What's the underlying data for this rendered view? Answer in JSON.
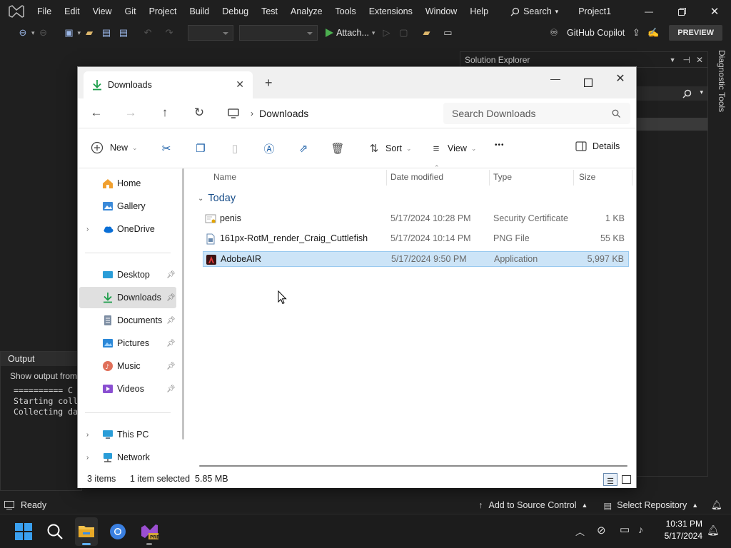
{
  "vs": {
    "menu": [
      "File",
      "Edit",
      "View",
      "Git",
      "Project",
      "Build",
      "Debug",
      "Test",
      "Analyze",
      "Tools",
      "Extensions",
      "Window",
      "Help"
    ],
    "search_label": "Search",
    "project_title": "Project1",
    "toolbar": {
      "attach_label": "Attach...",
      "copilot_label": "GitHub Copilot",
      "preview_label": "PREVIEW"
    },
    "solution_explorer_title": "Solution Explorer",
    "diagnostic_tools_title": "Diagnostic Tools",
    "output": {
      "title": "Output",
      "show_output_from": "Show output from",
      "lines": "========== C\nStarting coll\nCollecting da"
    },
    "status": {
      "ready": "Ready",
      "add_to_source_control": "Add to Source Control",
      "select_repository": "Select Repository"
    }
  },
  "explorer": {
    "tab_title": "Downloads",
    "address": "Downloads",
    "search_placeholder": "Search Downloads",
    "commands": {
      "new": "New",
      "sort": "Sort",
      "view": "View",
      "more": "•••",
      "details": "Details"
    },
    "sidebar": {
      "home": "Home",
      "gallery": "Gallery",
      "onedrive": "OneDrive",
      "desktop": "Desktop",
      "downloads": "Downloads",
      "documents": "Documents",
      "pictures": "Pictures",
      "music": "Music",
      "videos": "Videos",
      "this_pc": "This PC",
      "network": "Network"
    },
    "columns": {
      "name": "Name",
      "date_modified": "Date modified",
      "type": "Type",
      "size": "Size"
    },
    "group_label": "Today",
    "files": [
      {
        "name": "penis",
        "date": "5/17/2024 10:28 PM",
        "type": "Security Certificate",
        "size": "1 KB"
      },
      {
        "name": "161px-RotM_render_Craig_Cuttlefish",
        "date": "5/17/2024 10:14 PM",
        "type": "PNG File",
        "size": "55 KB"
      },
      {
        "name": "AdobeAIR",
        "date": "5/17/2024 9:50 PM",
        "type": "Application",
        "size": "5,997 KB"
      }
    ],
    "status": {
      "items": "3 items",
      "selected": "1 item selected  5.85 MB"
    }
  },
  "taskbar": {
    "time": "10:31 PM",
    "date": "5/17/2024"
  },
  "colors": {
    "vs_bg": "#1f1f1f",
    "selection": "#cce4f7",
    "accent_blue": "#0067c0",
    "vs_purple": "#9b4fd1"
  }
}
